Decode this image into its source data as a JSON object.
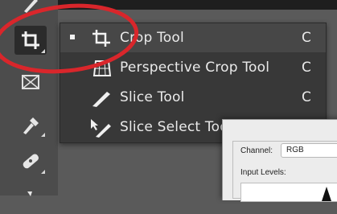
{
  "toolbar": {
    "tools": [
      {
        "name": "brush-tool",
        "icon": "brush-icon"
      },
      {
        "name": "crop-tool",
        "icon": "crop-icon",
        "selected": true
      },
      {
        "name": "frame-tool",
        "icon": "frame-icon"
      },
      {
        "name": "eyedropper-tool",
        "icon": "eyedropper-icon"
      },
      {
        "name": "healing-brush-tool",
        "icon": "bandage-icon"
      }
    ]
  },
  "flyout": {
    "items": [
      {
        "label": "Crop Tool",
        "shortcut": "C",
        "icon": "crop-icon",
        "active": true
      },
      {
        "label": "Perspective Crop Tool",
        "shortcut": "C",
        "icon": "perspective-crop-icon"
      },
      {
        "label": "Slice Tool",
        "shortcut": "C",
        "icon": "slice-icon"
      },
      {
        "label": "Slice Select Tool",
        "shortcut": "C",
        "icon": "slice-select-icon"
      }
    ]
  },
  "dialog": {
    "channel_label": "Channel:",
    "channel_value": "RGB",
    "input_levels_label": "Input Levels:"
  },
  "colors": {
    "menu_bg": "#383838",
    "highlight_ring": "#d9262b",
    "text": "#eaeaea"
  }
}
